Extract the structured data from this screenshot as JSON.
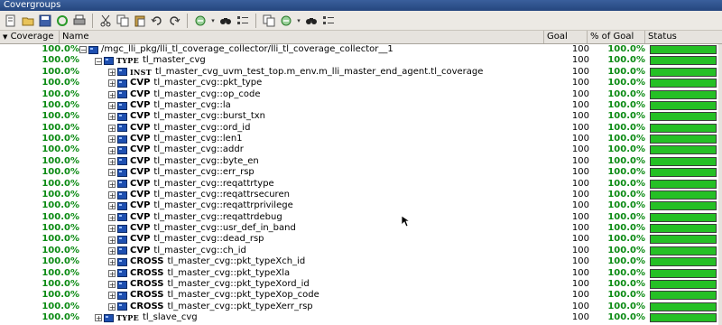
{
  "window": {
    "title": "Covergroups"
  },
  "toolbar": {
    "icons": [
      "report-icon",
      "open-icon",
      "save-icon",
      "refresh-icon",
      "print-icon",
      "cut-icon",
      "copy-icon",
      "paste-icon",
      "undo-icon",
      "redo-icon",
      "filter-icon",
      "find-icon",
      "columns-icon",
      "copy2-icon",
      "filter2-icon",
      "find2-icon",
      "columns2-icon"
    ]
  },
  "columns": {
    "coverage": "Coverage",
    "name": "Name",
    "goal": "Goal",
    "pct_goal": "% of Goal",
    "status": "Status"
  },
  "colors": {
    "green_text": "#0a8a12",
    "bar_fill": "#25c025"
  },
  "rows": [
    {
      "coverage": "100.0%",
      "kind": "",
      "label": "/mgc_lli_pkg/lli_tl_coverage_collector/lli_tl_coverage_collector__1",
      "goal": "100",
      "pct": "100.0%",
      "status": 1.0,
      "indent": 0,
      "icon": "package-icon"
    },
    {
      "coverage": "100.0%",
      "kind": "TYPE",
      "label": "tl_master_cvg",
      "goal": "100",
      "pct": "100.0%",
      "status": 1.0,
      "indent": 1,
      "icon": "type-icon"
    },
    {
      "coverage": "100.0%",
      "kind": "INST",
      "label": "tl_master_cvg_uvm_test_top.m_env.m_lli_master_end_agent.tl_coverage",
      "goal": "100",
      "pct": "100.0%",
      "status": 1.0,
      "indent": 2,
      "icon": "instance-icon"
    },
    {
      "coverage": "100.0%",
      "kind": "CVP",
      "label": "tl_master_cvg::pkt_type",
      "goal": "100",
      "pct": "100.0%",
      "status": 1.0,
      "indent": 2,
      "icon": "coverpoint-icon"
    },
    {
      "coverage": "100.0%",
      "kind": "CVP",
      "label": "tl_master_cvg::op_code",
      "goal": "100",
      "pct": "100.0%",
      "status": 1.0,
      "indent": 2,
      "icon": "coverpoint-icon"
    },
    {
      "coverage": "100.0%",
      "kind": "CVP",
      "label": "tl_master_cvg::la",
      "goal": "100",
      "pct": "100.0%",
      "status": 1.0,
      "indent": 2,
      "icon": "coverpoint-icon"
    },
    {
      "coverage": "100.0%",
      "kind": "CVP",
      "label": "tl_master_cvg::burst_txn",
      "goal": "100",
      "pct": "100.0%",
      "status": 1.0,
      "indent": 2,
      "icon": "coverpoint-icon"
    },
    {
      "coverage": "100.0%",
      "kind": "CVP",
      "label": "tl_master_cvg::ord_id",
      "goal": "100",
      "pct": "100.0%",
      "status": 1.0,
      "indent": 2,
      "icon": "coverpoint-icon"
    },
    {
      "coverage": "100.0%",
      "kind": "CVP",
      "label": "tl_master_cvg::len1",
      "goal": "100",
      "pct": "100.0%",
      "status": 1.0,
      "indent": 2,
      "icon": "coverpoint-icon"
    },
    {
      "coverage": "100.0%",
      "kind": "CVP",
      "label": "tl_master_cvg::addr",
      "goal": "100",
      "pct": "100.0%",
      "status": 1.0,
      "indent": 2,
      "icon": "coverpoint-icon"
    },
    {
      "coverage": "100.0%",
      "kind": "CVP",
      "label": "tl_master_cvg::byte_en",
      "goal": "100",
      "pct": "100.0%",
      "status": 1.0,
      "indent": 2,
      "icon": "coverpoint-icon"
    },
    {
      "coverage": "100.0%",
      "kind": "CVP",
      "label": "tl_master_cvg::err_rsp",
      "goal": "100",
      "pct": "100.0%",
      "status": 1.0,
      "indent": 2,
      "icon": "coverpoint-icon"
    },
    {
      "coverage": "100.0%",
      "kind": "CVP",
      "label": "tl_master_cvg::reqattrtype",
      "goal": "100",
      "pct": "100.0%",
      "status": 1.0,
      "indent": 2,
      "icon": "coverpoint-icon"
    },
    {
      "coverage": "100.0%",
      "kind": "CVP",
      "label": "tl_master_cvg::reqattrsecuren",
      "goal": "100",
      "pct": "100.0%",
      "status": 1.0,
      "indent": 2,
      "icon": "coverpoint-icon"
    },
    {
      "coverage": "100.0%",
      "kind": "CVP",
      "label": "tl_master_cvg::reqattrprivilege",
      "goal": "100",
      "pct": "100.0%",
      "status": 1.0,
      "indent": 2,
      "icon": "coverpoint-icon"
    },
    {
      "coverage": "100.0%",
      "kind": "CVP",
      "label": "tl_master_cvg::reqattrdebug",
      "goal": "100",
      "pct": "100.0%",
      "status": 1.0,
      "indent": 2,
      "icon": "coverpoint-icon"
    },
    {
      "coverage": "100.0%",
      "kind": "CVP",
      "label": "tl_master_cvg::usr_def_in_band",
      "goal": "100",
      "pct": "100.0%",
      "status": 1.0,
      "indent": 2,
      "icon": "coverpoint-icon"
    },
    {
      "coverage": "100.0%",
      "kind": "CVP",
      "label": "tl_master_cvg::dead_rsp",
      "goal": "100",
      "pct": "100.0%",
      "status": 1.0,
      "indent": 2,
      "icon": "coverpoint-icon"
    },
    {
      "coverage": "100.0%",
      "kind": "CVP",
      "label": "tl_master_cvg::ch_id",
      "goal": "100",
      "pct": "100.0%",
      "status": 1.0,
      "indent": 2,
      "icon": "coverpoint-icon"
    },
    {
      "coverage": "100.0%",
      "kind": "CROSS",
      "label": "tl_master_cvg::pkt_typeXch_id",
      "goal": "100",
      "pct": "100.0%",
      "status": 1.0,
      "indent": 2,
      "icon": "cross-icon"
    },
    {
      "coverage": "100.0%",
      "kind": "CROSS",
      "label": "tl_master_cvg::pkt_typeXla",
      "goal": "100",
      "pct": "100.0%",
      "status": 1.0,
      "indent": 2,
      "icon": "cross-icon"
    },
    {
      "coverage": "100.0%",
      "kind": "CROSS",
      "label": "tl_master_cvg::pkt_typeXord_id",
      "goal": "100",
      "pct": "100.0%",
      "status": 1.0,
      "indent": 2,
      "icon": "cross-icon"
    },
    {
      "coverage": "100.0%",
      "kind": "CROSS",
      "label": "tl_master_cvg::pkt_typeXop_code",
      "goal": "100",
      "pct": "100.0%",
      "status": 1.0,
      "indent": 2,
      "icon": "cross-icon"
    },
    {
      "coverage": "100.0%",
      "kind": "CROSS",
      "label": "tl_master_cvg::pkt_typeXerr_rsp",
      "goal": "100",
      "pct": "100.0%",
      "status": 1.0,
      "indent": 2,
      "icon": "cross-icon"
    },
    {
      "coverage": "100.0%",
      "kind": "TYPE",
      "label": "tl_slave_cvg",
      "goal": "100",
      "pct": "100.0%",
      "status": 1.0,
      "indent": 1,
      "icon": "type-icon"
    }
  ]
}
